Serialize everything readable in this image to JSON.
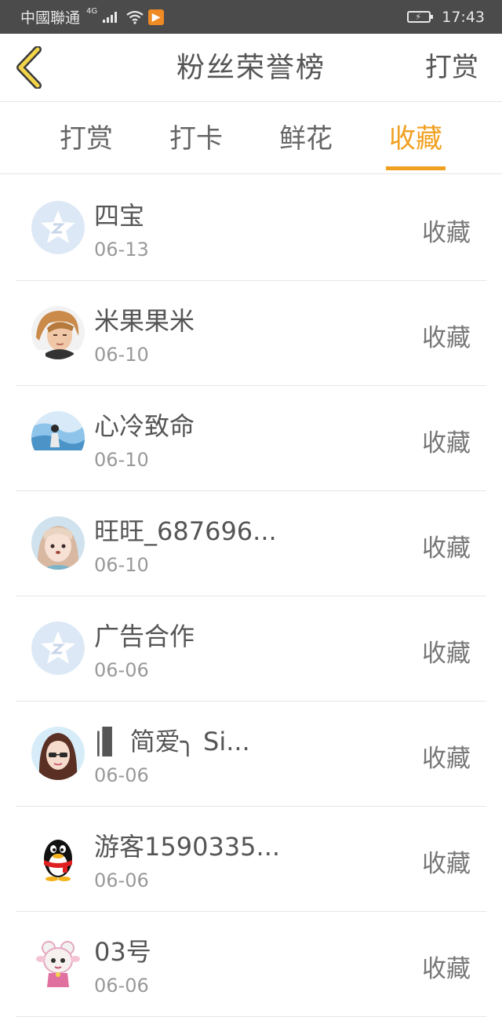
{
  "status_bar": {
    "carrier": "中國聯通",
    "network": "4G",
    "time": "17:43"
  },
  "nav": {
    "title": "粉丝荣誉榜",
    "action": "打赏"
  },
  "tabs": [
    {
      "label": "打赏",
      "active": false
    },
    {
      "label": "打卡",
      "active": false
    },
    {
      "label": "鲜花",
      "active": false
    },
    {
      "label": "收藏",
      "active": true
    }
  ],
  "accent_color": "#f0a020",
  "list": [
    {
      "name": "四宝",
      "date": "06-13",
      "action": "收藏",
      "avatar": "default-star-avatar"
    },
    {
      "name": "米果果米",
      "date": "06-10",
      "action": "收藏",
      "avatar": "boy-photo-avatar"
    },
    {
      "name": "心冷致命",
      "date": "06-10",
      "action": "收藏",
      "avatar": "blue-scene-avatar"
    },
    {
      "name": "旺旺_687696...",
      "date": "06-10",
      "action": "收藏",
      "avatar": "girl-photo-avatar"
    },
    {
      "name": "广告合作",
      "date": "06-06",
      "action": "收藏",
      "avatar": "default-star-avatar"
    },
    {
      "name": "|▌ 简爱╮ Si...",
      "date": "06-06",
      "action": "收藏",
      "avatar": "cartoon-girl-avatar"
    },
    {
      "name": "游客1590335...",
      "date": "06-06",
      "action": "收藏",
      "avatar": "qq-penguin-avatar"
    },
    {
      "name": "03号",
      "date": "06-06",
      "action": "收藏",
      "avatar": "sheep-avatar"
    }
  ]
}
